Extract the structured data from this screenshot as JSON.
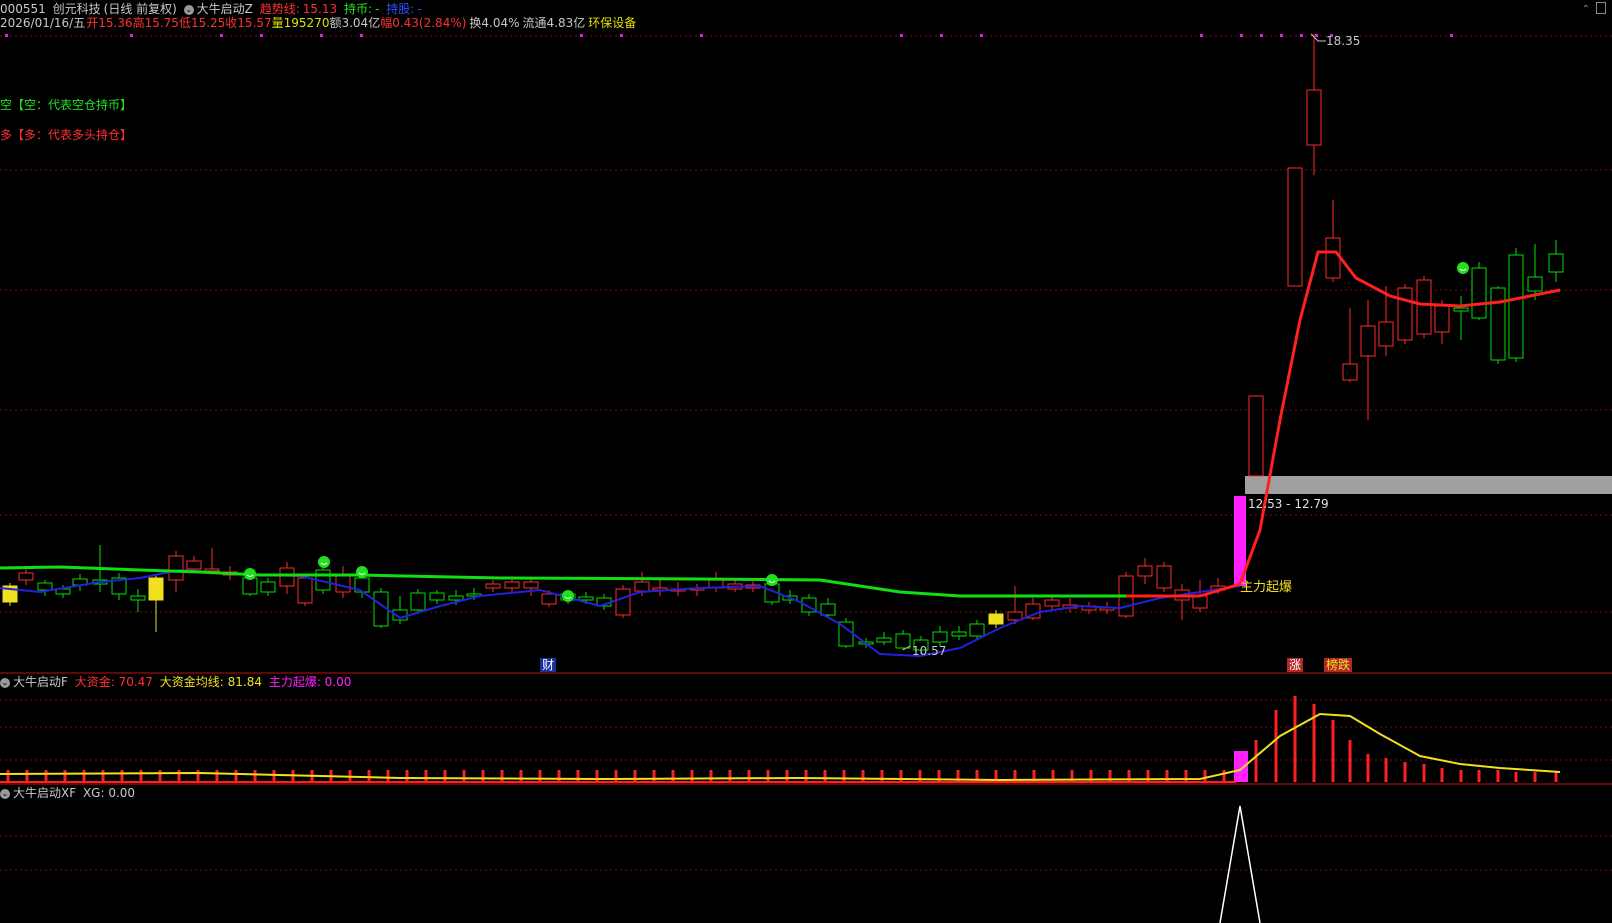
{
  "header": {
    "code": "000551",
    "name": "创元科技",
    "period": "(日线 前复权)",
    "indicator": "大牛启动Z",
    "trend_label": "趋势线:",
    "trend_value": "15.13",
    "hold_label": "持币:",
    "hold_value": "-",
    "hold_stock": "持股:",
    "hold_stock_value": "-"
  },
  "quote": {
    "date": "2026/01/16/五",
    "open": "开15.36",
    "high": "高15.75",
    "low": "低15.25",
    "close": "收15.57",
    "volume": "量195270",
    "amount": "额3.04亿",
    "change": "幅0.43(2.84%)",
    "turnover": "换4.04%",
    "float": "流通4.83亿",
    "sector": "环保设备"
  },
  "legend": {
    "empty": "空【空：代表空仓持币】",
    "long": "多【多：代表多头持仓】"
  },
  "main_chart": {
    "high_label": "18.35",
    "low_label": "10.57",
    "zone_label": "12.53 - 12.79",
    "burst_label": "主力起爆",
    "markers": [
      "财",
      "涨",
      "榜跌"
    ],
    "colors": {
      "up": "#ff2a2a",
      "down": "#00e000",
      "trend_up": "#ff2020",
      "trend_down": "#10e010",
      "ma": "#2020e0"
    }
  },
  "panel2": {
    "title": "大牛启动F",
    "big_fund": "大资金: 70.47",
    "big_fund_ma": "大资金均线: 81.84",
    "burst": "主力起爆: 0.00"
  },
  "panel3": {
    "title": "大牛启动XF",
    "xg": "XG: 0.00"
  }
}
